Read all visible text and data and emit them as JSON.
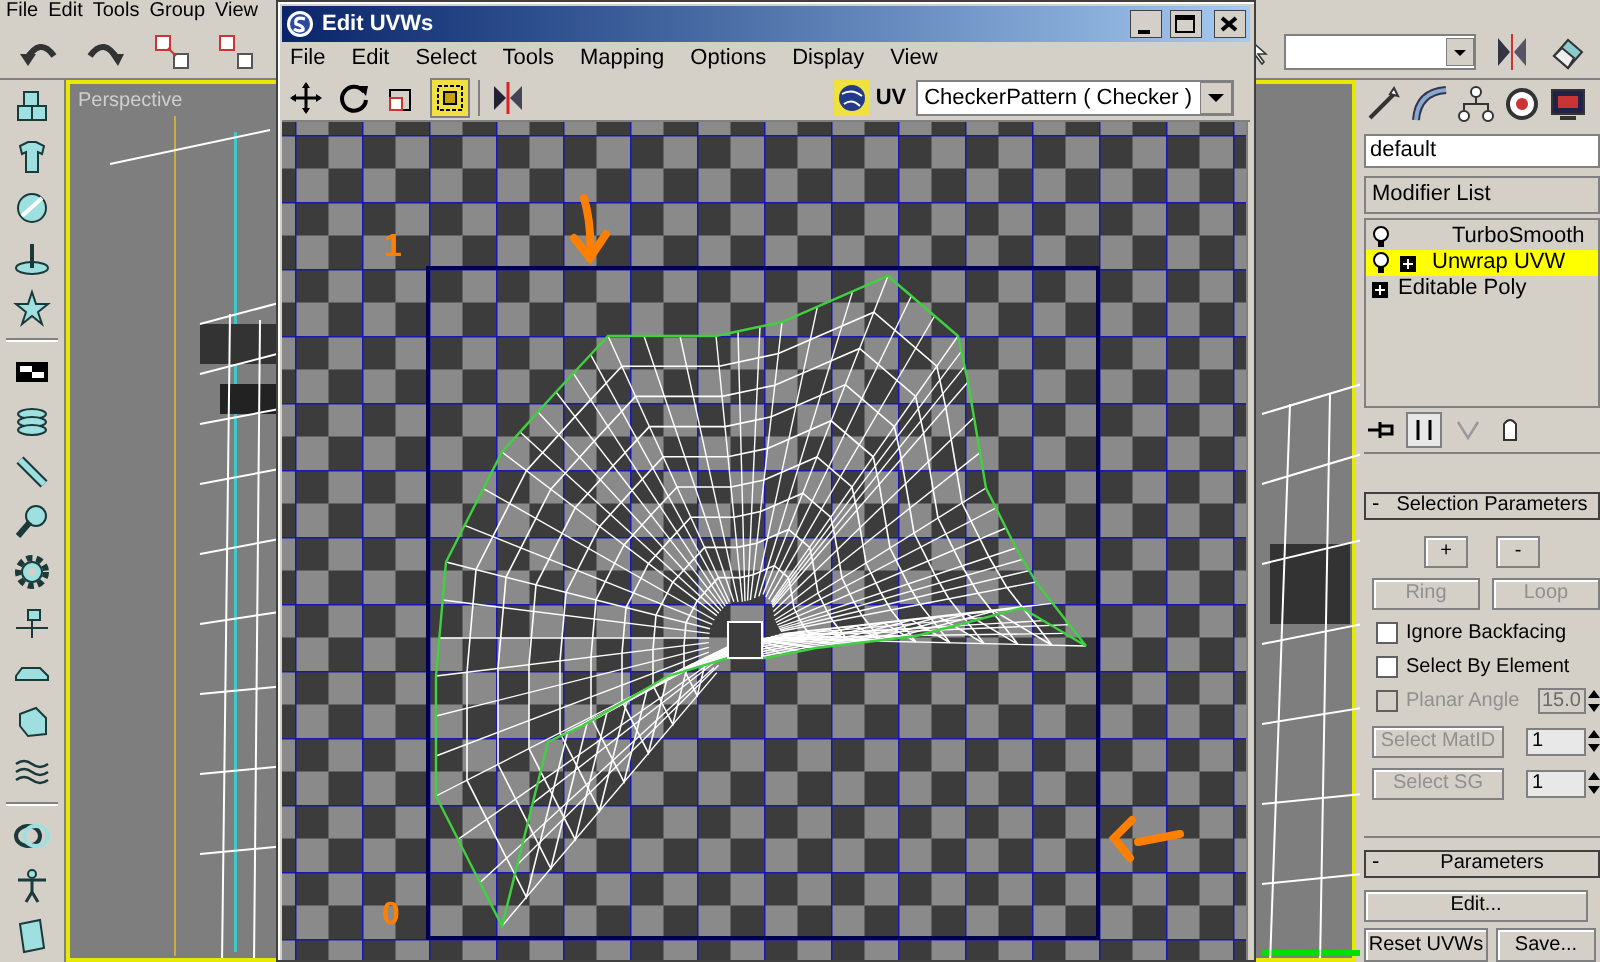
{
  "main_menu": [
    "File",
    "Edit",
    "Tools",
    "Group",
    "View"
  ],
  "viewport": {
    "label": "Perspective"
  },
  "uvw_editor": {
    "title": "Edit UVWs",
    "menu": [
      "File",
      "Edit",
      "Select",
      "Tools",
      "Mapping",
      "Options",
      "Display",
      "View"
    ],
    "tools": [
      {
        "kind": "move",
        "selected": false
      },
      {
        "kind": "rotate",
        "selected": false
      },
      {
        "kind": "scale",
        "selected": false
      },
      {
        "kind": "freeform",
        "selected": true
      },
      {
        "kind": "mirror",
        "selected": false
      }
    ],
    "uv_label": "UV",
    "texture_dropdown": "CheckerPattern ( Checker )",
    "annotations": [
      {
        "kind": "top",
        "text": "1"
      },
      {
        "kind": "bottom",
        "text": "0"
      }
    ]
  },
  "command_panel": {
    "object_name": "default",
    "modifier_list": "Modifier List",
    "stack": [
      {
        "label": "TurboSmooth",
        "kind": "modifier",
        "expandable": false,
        "selected": false
      },
      {
        "label": "Unwrap UVW",
        "kind": "modifier",
        "expandable": true,
        "selected": true
      },
      {
        "label": "Editable Poly",
        "kind": "base",
        "expandable": true,
        "selected": false
      }
    ],
    "selection_parameters": {
      "sign": "-",
      "title": "Selection Parameters",
      "grow_buttons": [
        "+",
        "-"
      ],
      "ring_loop": [
        {
          "label": "Ring",
          "disabled": true
        },
        {
          "label": "Loop",
          "disabled": true
        }
      ],
      "checkboxes": [
        {
          "label": "Ignore Backfacing",
          "checked": false,
          "disabled": false
        },
        {
          "label": "Select By Element",
          "checked": false,
          "disabled": false
        },
        {
          "label": "Planar Angle",
          "checked": false,
          "disabled": true,
          "value": "15.0"
        }
      ],
      "select_rows": [
        {
          "label": "Select MatID",
          "disabled": true,
          "value": "1"
        },
        {
          "label": "Select SG",
          "disabled": true,
          "value": "1"
        }
      ]
    },
    "parameters": {
      "sign": "-",
      "title": "Parameters",
      "edit_button": "Edit...",
      "buttons": [
        "Reset UVWs",
        "Save..."
      ]
    }
  }
}
